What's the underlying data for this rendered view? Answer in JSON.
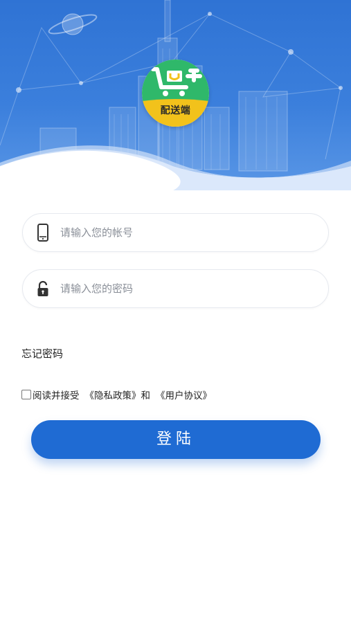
{
  "header": {
    "logo_text": "配送端"
  },
  "form": {
    "account_placeholder": "请输入您的帐号",
    "password_placeholder": "请输入您的密码",
    "forgot_password": "忘记密码",
    "agreement_prefix": "阅读并接受",
    "privacy_policy_link": "《隐私政策》",
    "agreement_and": "和",
    "user_agreement_link": "《用户协议》",
    "agree_checked": false,
    "login_label": "登陆"
  },
  "icons": {
    "account": "phone-icon",
    "password": "lock-icon"
  },
  "colors": {
    "primary": "#1f6bd3",
    "hero_bg": "#2f73d4",
    "logo_green": "#2fb86a",
    "logo_yellow": "#f2c21b"
  }
}
